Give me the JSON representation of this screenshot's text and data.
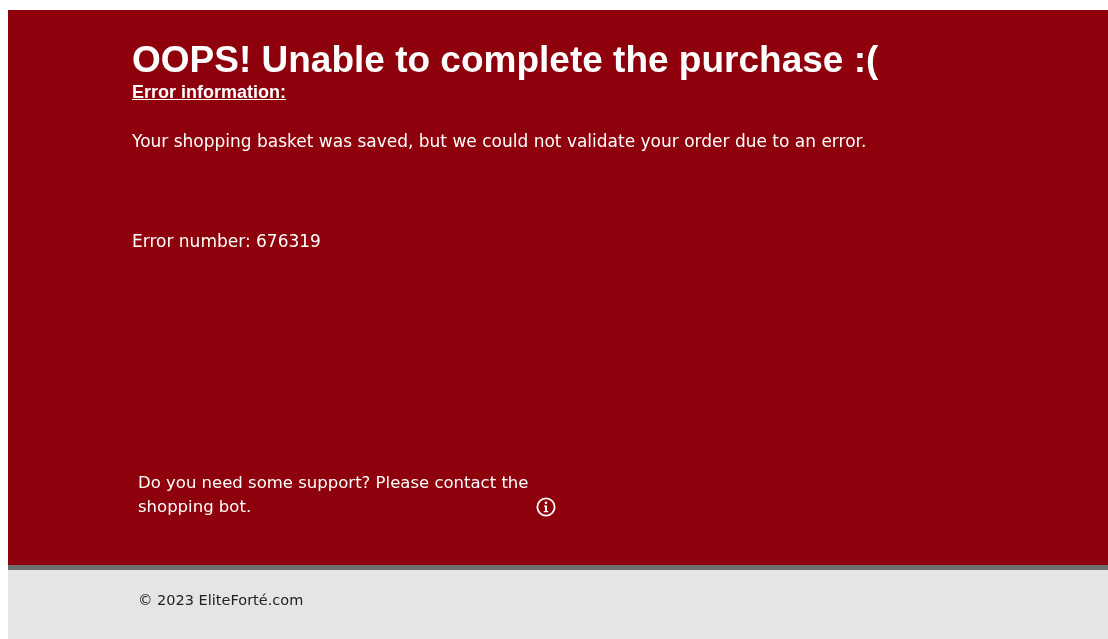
{
  "error_panel": {
    "title": "OOPS! Unable to complete the purchase :(",
    "subtitle": "Error information: ",
    "message": "Your shopping basket was saved, but we could not validate your order due to an error.",
    "error_number": "Error number: 676319",
    "support_text": "Do you need some support? Please contact the shopping bot."
  },
  "footer": {
    "copyright": "© 2023 EliteForté.com"
  }
}
